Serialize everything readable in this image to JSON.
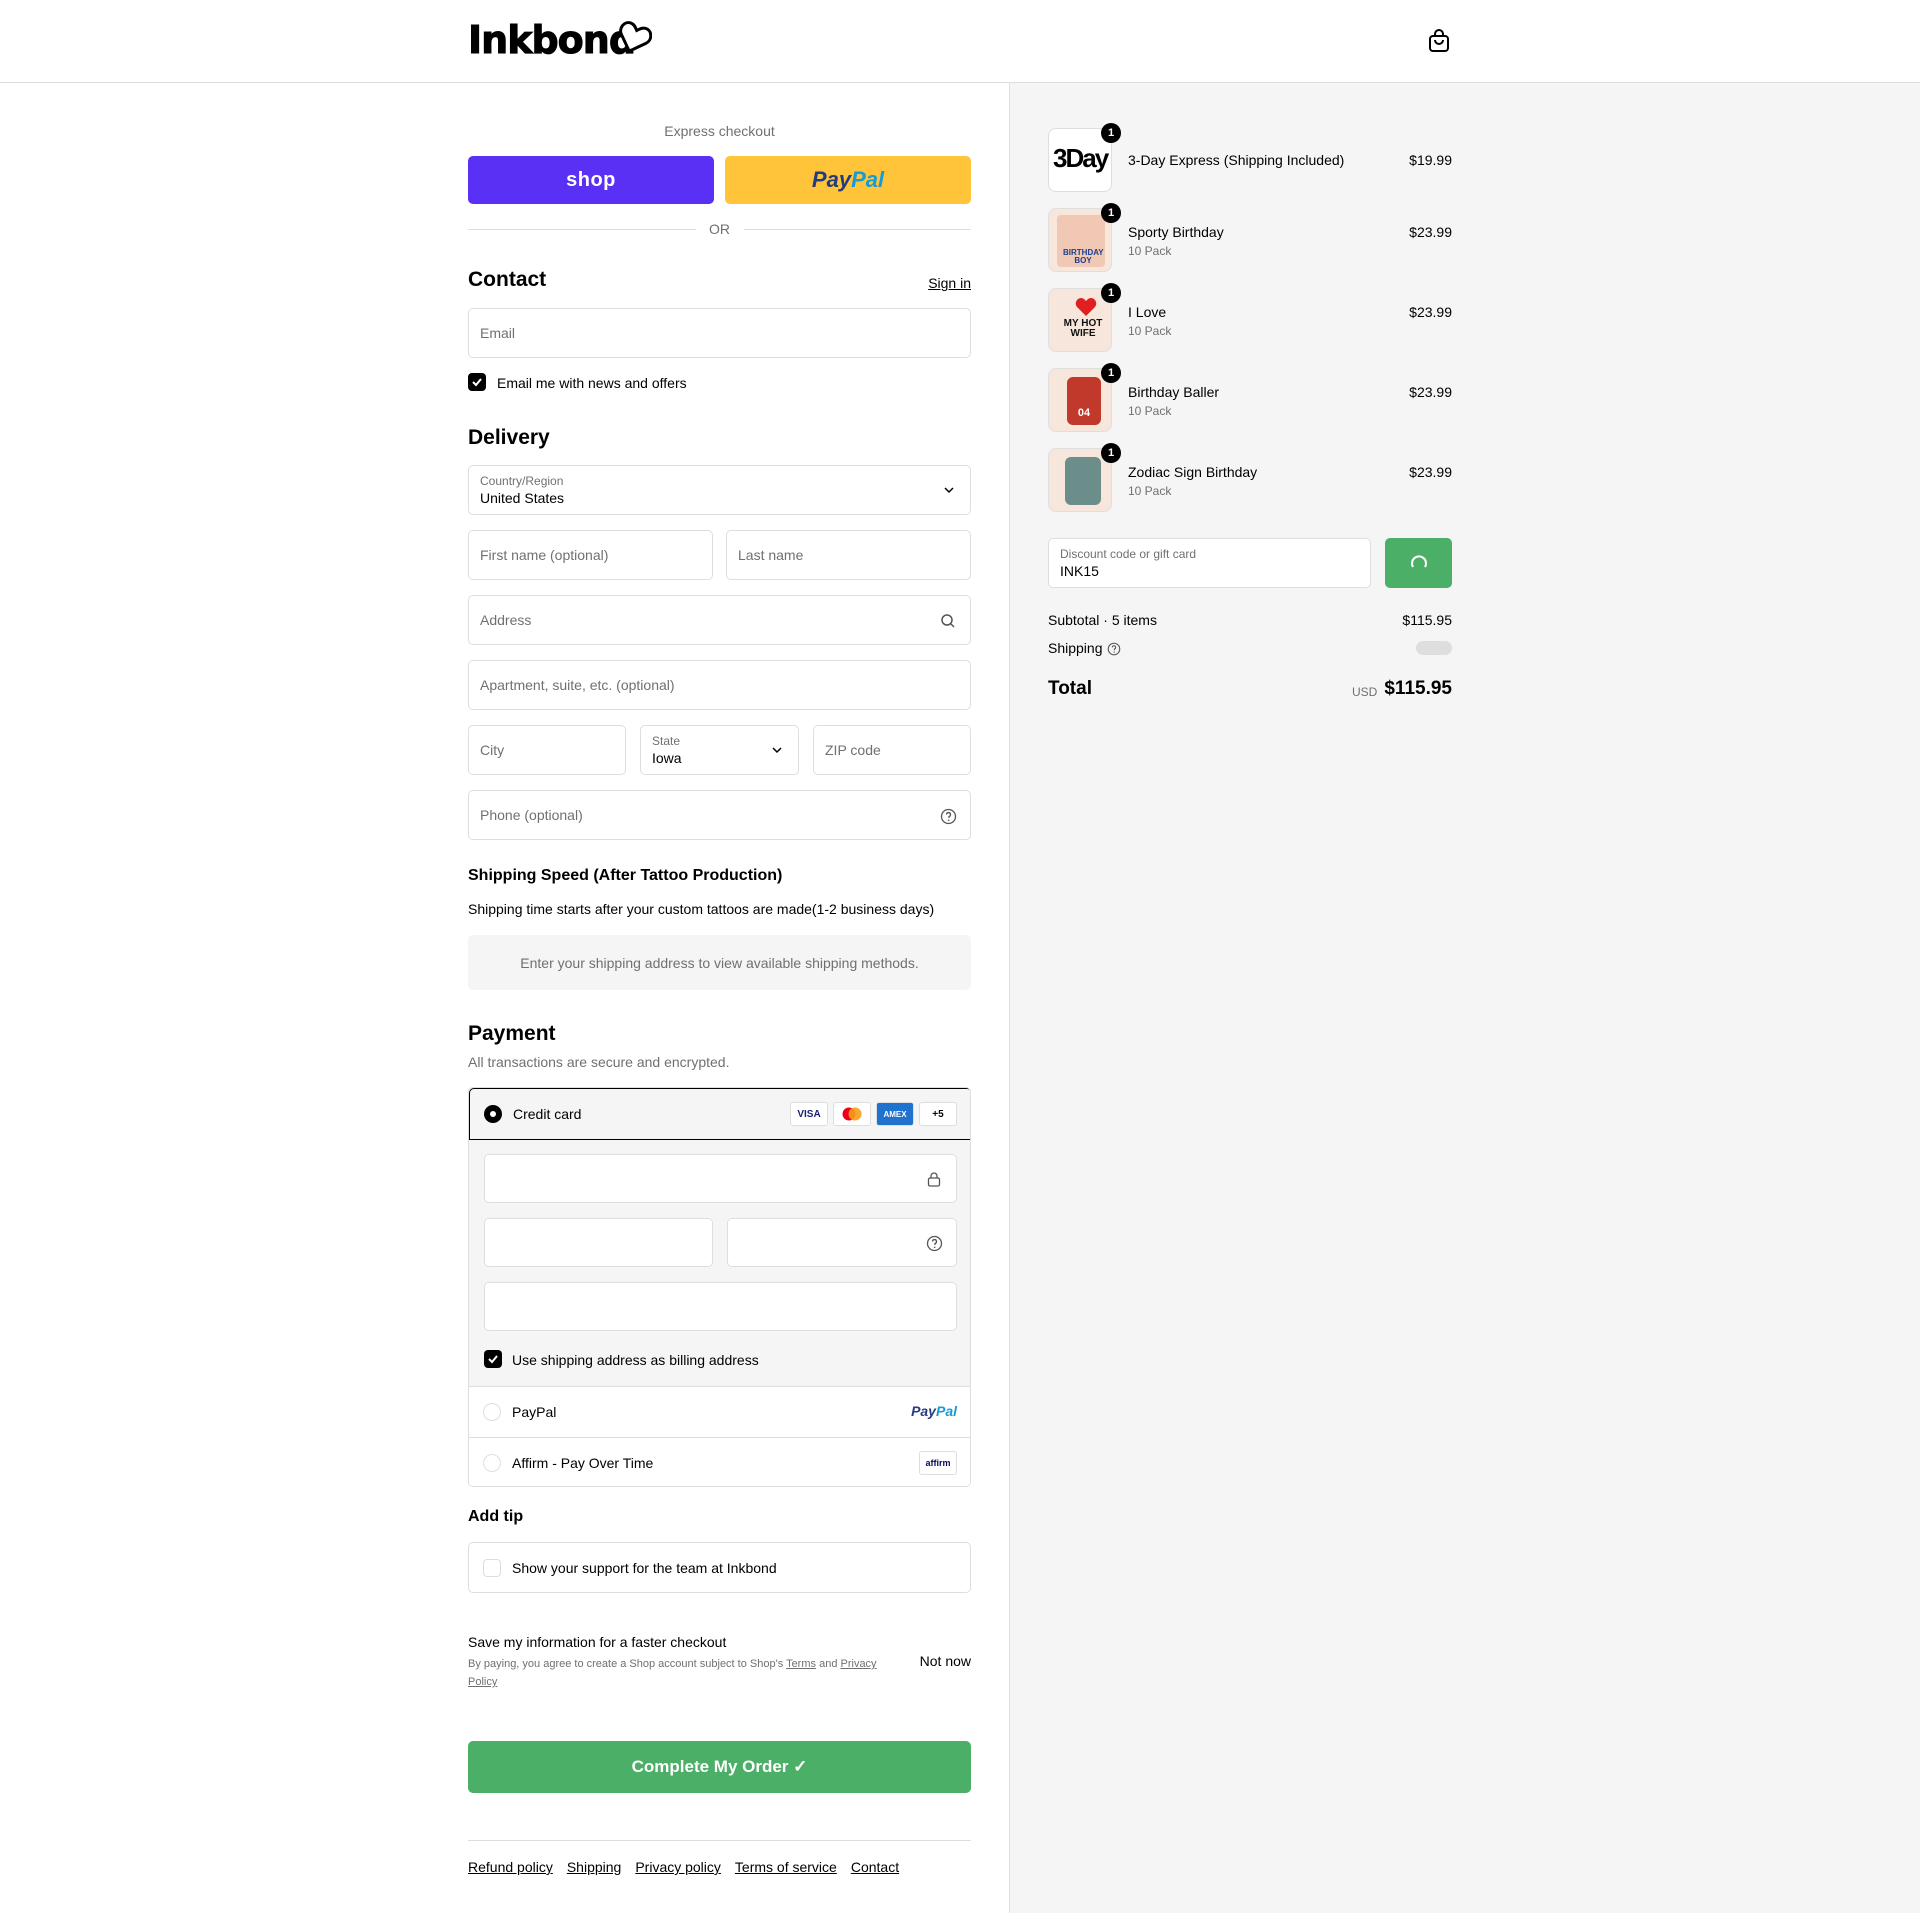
{
  "header": {
    "logo": "Inkbond"
  },
  "express": {
    "label": "Express checkout",
    "shop_label": "shop",
    "paypal_1": "Pay",
    "paypal_2": "Pal",
    "or": "OR"
  },
  "contact": {
    "title": "Contact",
    "sign_in": "Sign in",
    "email_placeholder": "Email",
    "news_label": "Email me with news and offers"
  },
  "delivery": {
    "title": "Delivery",
    "country_label": "Country/Region",
    "country_value": "United States",
    "first_name": "First name (optional)",
    "last_name": "Last name",
    "address": "Address",
    "apartment": "Apartment, suite, etc. (optional)",
    "city": "City",
    "state_label": "State",
    "state_value": "Iowa",
    "zip": "ZIP code",
    "phone": "Phone (optional)"
  },
  "shipping": {
    "title": "Shipping Speed (After Tattoo Production)",
    "note": "Shipping time starts after your custom tattoos are made(1-2 business days)",
    "placeholder": "Enter your shipping address to view available shipping methods."
  },
  "payment": {
    "title": "Payment",
    "subtitle": "All transactions are secure and encrypted.",
    "credit_card": "Credit card",
    "card_logos": [
      "VISA",
      "",
      "AMEX",
      "+5"
    ],
    "billing_label": "Use shipping address as billing address",
    "paypal": "PayPal",
    "affirm": "Affirm - Pay Over Time",
    "affirm_logo": "affirm"
  },
  "tip": {
    "title": "Add tip",
    "label": "Show your support for the team at Inkbond"
  },
  "save": {
    "title": "Save my information for a faster checkout",
    "legal_1": "By paying, you agree to create a Shop account subject to Shop's",
    "terms": "Terms",
    "and": "and",
    "privacy": "Privacy Policy",
    "not_now": "Not now"
  },
  "complete_button": "Complete My Order ✓",
  "footer_links": [
    "Refund policy",
    "Shipping",
    "Privacy policy",
    "Terms of service",
    "Contact"
  ],
  "cart": {
    "items": [
      {
        "name": "3-Day Express (Shipping Included)",
        "sub": "",
        "price": "$19.99",
        "qty": "1",
        "thumb": "3Day"
      },
      {
        "name": "Sporty Birthday",
        "sub": "10 Pack",
        "price": "$23.99",
        "qty": "1",
        "thumb": "BIRTHDAY BOY"
      },
      {
        "name": "I Love",
        "sub": "10 Pack",
        "price": "$23.99",
        "qty": "1",
        "thumb": "MY HOT WIFE"
      },
      {
        "name": "Birthday Baller",
        "sub": "10 Pack",
        "price": "$23.99",
        "qty": "1",
        "thumb": "04"
      },
      {
        "name": "Zodiac Sign Birthday",
        "sub": "10 Pack",
        "price": "$23.99",
        "qty": "1",
        "thumb": ""
      }
    ],
    "discount_label": "Discount code or gift card",
    "discount_value": "INK15",
    "subtotal_label": "Subtotal · 5 items",
    "subtotal_value": "$115.95",
    "shipping_label": "Shipping",
    "total_label": "Total",
    "currency": "USD",
    "total_value": "$115.95"
  },
  "colors": {
    "shop": "#5a31f4",
    "paypal": "#ffc439",
    "accent": "#4caf68"
  }
}
